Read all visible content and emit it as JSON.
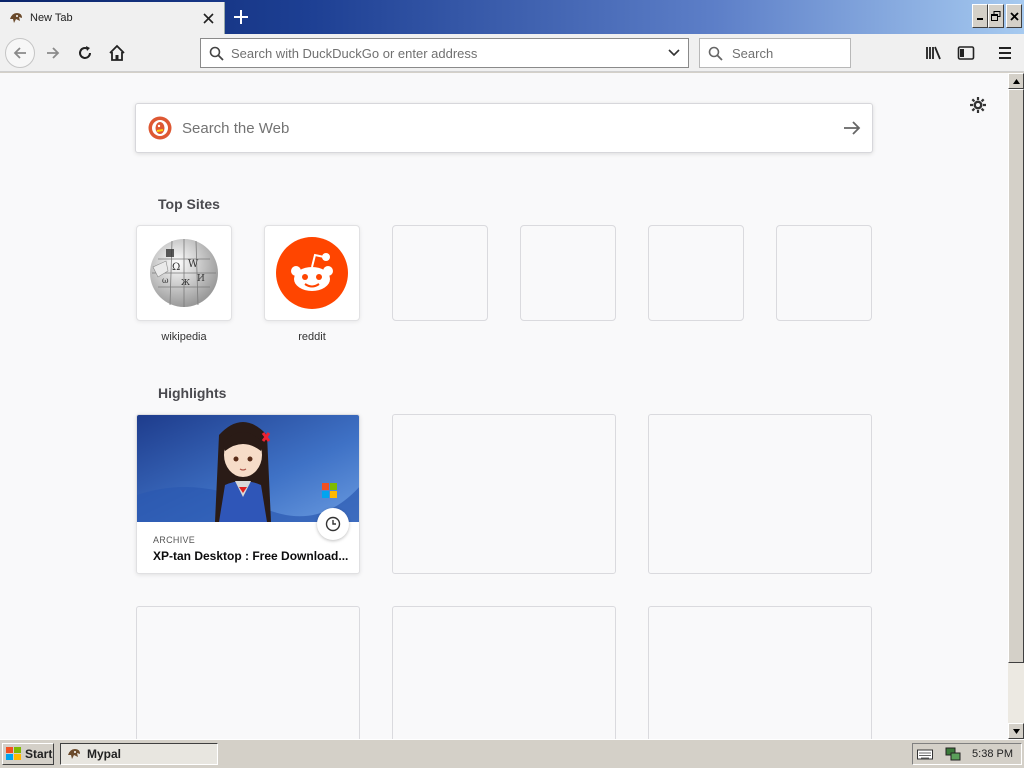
{
  "tab": {
    "title": "New Tab",
    "close_icon": "close-icon",
    "new_tab_icon": "plus-icon"
  },
  "window_controls": [
    "minimize",
    "restore",
    "close"
  ],
  "toolbar": {
    "url_placeholder": "Search with DuckDuckGo or enter address",
    "search_placeholder": "Search"
  },
  "newtab": {
    "web_search_placeholder": "Search the Web",
    "top_sites_title": "Top Sites",
    "top_sites": [
      {
        "label": "wikipedia",
        "icon": "wikipedia-globe-icon"
      },
      {
        "label": "reddit",
        "icon": "reddit-icon",
        "color": "#ff4500"
      },
      {
        "label": ""
      },
      {
        "label": ""
      },
      {
        "label": ""
      },
      {
        "label": ""
      }
    ],
    "highlights_title": "Highlights",
    "highlight": {
      "context": "ARCHIVE",
      "title": "XP-tan Desktop : Free Download..."
    }
  },
  "taskbar": {
    "start_label": "Start",
    "task_label": "Mypal",
    "clock": "5:38 PM"
  }
}
